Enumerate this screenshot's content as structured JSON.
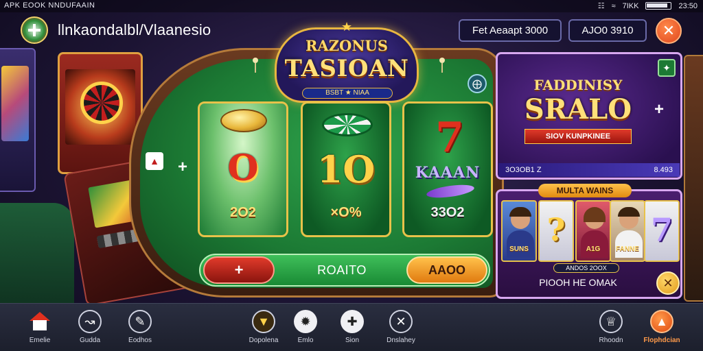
{
  "status_bar": {
    "left_text": "APK EOOK NNDUFAAIN",
    "right_text": "7IKK",
    "time": "23:50"
  },
  "header": {
    "app_title": "llnkaondalbl/Vlaanesio",
    "field_one": "Fet Aeaapt 3000",
    "field_two": "AJO0 3910"
  },
  "table": {
    "title_top": "RAZONUS",
    "title_main": "TASIOAN",
    "title_sub": "BSBT ★ NIAA",
    "reels": [
      {
        "symbol": "O",
        "value": "2O2"
      },
      {
        "symbol": "1O",
        "value": "×O%"
      },
      {
        "symbol": "KAAAN",
        "value": "33O2"
      }
    ],
    "buttons": {
      "minus": "+",
      "rotate": "ROAITO",
      "add": "AAOO"
    }
  },
  "promo": {
    "title_line1": "FADDINISY",
    "title_line2": "SRALO",
    "ribbon": "SIOV KUNPKINEE",
    "bar_left": "3O3OB1 Z",
    "bar_right": "8.493"
  },
  "wins": {
    "title": "MULTA WAINS",
    "cards": [
      {
        "kind": "person",
        "tag": "SUNS"
      },
      {
        "kind": "symbol",
        "big": "?",
        "color": "#ffd24a"
      },
      {
        "kind": "person",
        "tag": "A1G"
      },
      {
        "kind": "person",
        "tag": "FANNE"
      },
      {
        "kind": "symbol",
        "big": "7",
        "color": "#b89aff"
      }
    ],
    "sub_label": "ANDOS 2OOX",
    "footer": "PIOOH HE OMAK"
  },
  "bottom_nav": [
    {
      "label": "Emelie",
      "icon": "home-icon",
      "style": "home"
    },
    {
      "label": "Gudda",
      "icon": "stats-icon",
      "style": "plain"
    },
    {
      "label": "Eodhos",
      "icon": "edit-icon",
      "style": "plain"
    },
    {
      "label": "Dopolena",
      "icon": "shield-icon",
      "style": "badge"
    },
    {
      "label": "Emlo",
      "icon": "chip-icon",
      "style": "solid"
    },
    {
      "label": "Sion",
      "icon": "spin-icon",
      "style": "solid"
    },
    {
      "label": "Dnslahey",
      "icon": "cancel-icon",
      "style": "plain"
    },
    {
      "label": "Rhoodn",
      "icon": "trophy-icon",
      "style": "plain"
    },
    {
      "label": "Flophdcian",
      "icon": "promo-icon",
      "style": "accent"
    }
  ]
}
